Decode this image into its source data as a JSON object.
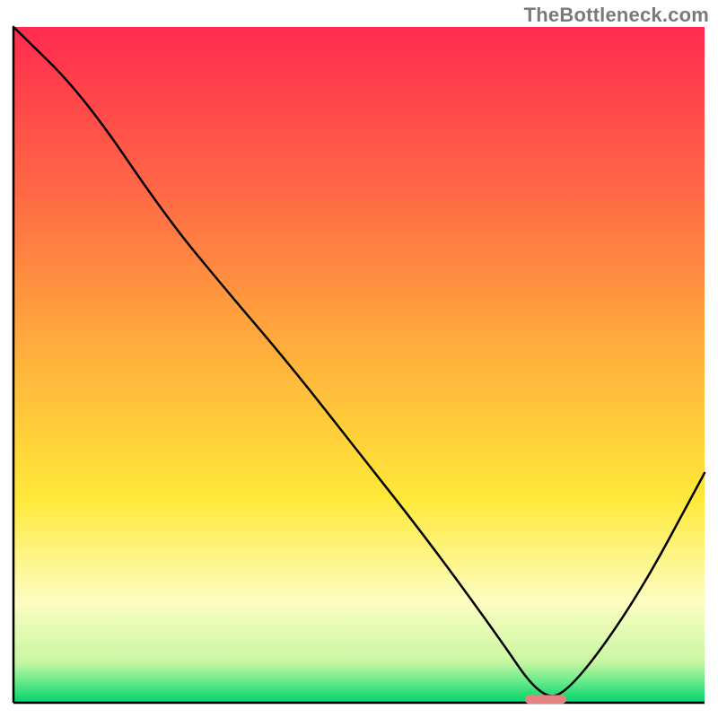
{
  "watermark": "TheBottleneck.com",
  "chart_data": {
    "type": "line",
    "title": "",
    "xlabel": "",
    "ylabel": "",
    "xlim": [
      0,
      100
    ],
    "ylim": [
      0,
      100
    ],
    "grid": false,
    "legend": false,
    "series": [
      {
        "name": "bottleneck-curve",
        "x": [
          0,
          10,
          22,
          30,
          40,
          50,
          60,
          70,
          76,
          80,
          90,
          100
        ],
        "y": [
          100,
          90,
          72,
          62,
          50,
          37,
          24,
          10,
          1,
          1,
          15,
          34
        ]
      }
    ],
    "marker": {
      "name": "optimal-zone",
      "x": 77,
      "y": 0.5,
      "width": 6,
      "height": 1.3,
      "color": "#e8817f"
    },
    "background_gradient": {
      "stops": [
        {
          "pos": 0.0,
          "color": "#ff2b4e"
        },
        {
          "pos": 0.25,
          "color": "#ff6a45"
        },
        {
          "pos": 0.5,
          "color": "#ffb53b"
        },
        {
          "pos": 0.7,
          "color": "#ffe93a"
        },
        {
          "pos": 0.85,
          "color": "#fdfec2"
        },
        {
          "pos": 0.94,
          "color": "#c8f7a4"
        },
        {
          "pos": 0.97,
          "color": "#62e989"
        },
        {
          "pos": 1.0,
          "color": "#00d36a"
        }
      ]
    }
  }
}
